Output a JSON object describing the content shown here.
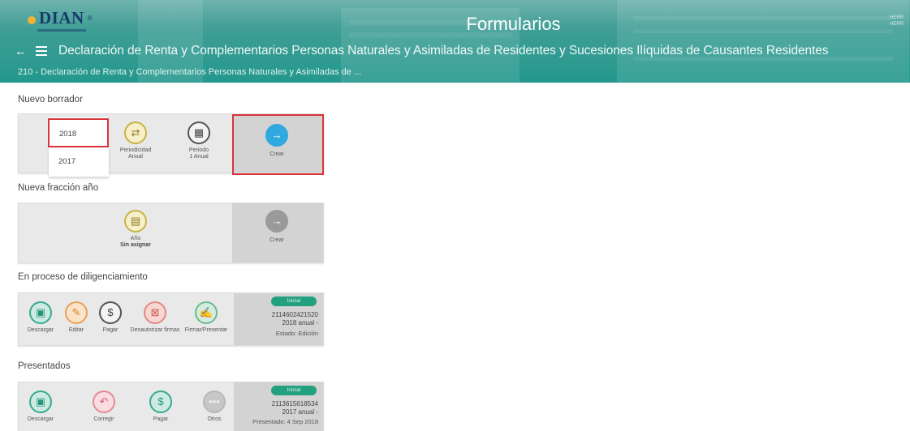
{
  "header": {
    "logo_text": "DIAN",
    "logo_tm": "®",
    "title": "Formularios",
    "right_text": [
      "HERR",
      "HERR"
    ],
    "nav_title": "Declaración de Renta y Complementarios Personas Naturales y Asimiladas de Residentes y Sucesiones Ilíquidas de Causantes Residentes",
    "sub_title": "210 - Declaración de Renta y Complementarios Personas Naturales y Asimiladas de ...",
    "colors": {
      "accent": "#23988d",
      "highlight": "#d9343b"
    }
  },
  "nuevo_borrador": {
    "title": "Nuevo borrador",
    "years": [
      "2018",
      "2017"
    ],
    "periodicidad": {
      "label": "Periodicidad",
      "value": "Anual"
    },
    "periodo": {
      "label": "Periodo",
      "value": "1 Anual"
    },
    "crear": "Crear"
  },
  "nueva_fraccion": {
    "title": "Nueva fracción año",
    "anio": {
      "label": "Año",
      "value": "Sin asignar"
    },
    "crear": "Crear"
  },
  "en_proceso": {
    "title": "En proceso de diligenciamiento",
    "actions": [
      "Descargar",
      "Editar",
      "Pagar",
      "Desautorizar firmas",
      "Firmar/Presentar"
    ],
    "badge": "Inicial",
    "number": "2114602421520",
    "period": "2018 anual -",
    "status": "Estado: Edición"
  },
  "presentados": {
    "title": "Presentados",
    "actions": [
      "Descargar",
      "Corregir",
      "Pagar",
      "Otros"
    ],
    "badge": "Inicial",
    "number": "2113615618534",
    "period": "2017 anual -",
    "status": "Presentado: 4 Sep 2018"
  }
}
